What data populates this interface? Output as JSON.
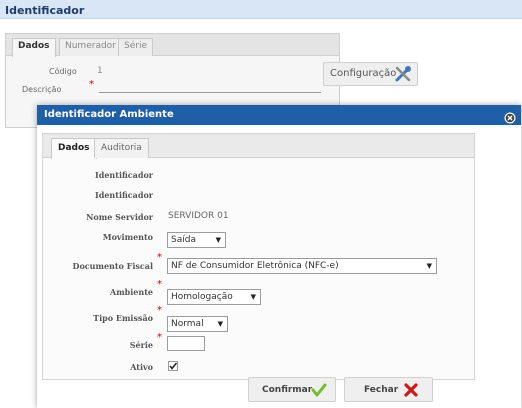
{
  "window": {
    "title": "Identificador"
  },
  "background_form": {
    "tabs": [
      "Dados",
      "Numerador",
      "Série"
    ],
    "fields": {
      "codigo_label": "Código",
      "codigo_value": "1",
      "descricao_label": "Descrição"
    },
    "config_button_label": "Configuração"
  },
  "modal": {
    "title": "Identificador Ambiente",
    "tabs": [
      "Dados",
      "Auditoria"
    ],
    "fields": {
      "identificador_1": {
        "label": "Identificador",
        "value": ""
      },
      "identificador_2": {
        "label": "Identificador",
        "value": ""
      },
      "nome_servidor": {
        "label": "Nome Servidor",
        "value": "SERVIDOR 01"
      },
      "movimento": {
        "label": "Movimento",
        "value": "Saída"
      },
      "documento_fiscal": {
        "label": "Documento Fiscal",
        "value": "NF de Consumidor Eletrônica (NFC-e)"
      },
      "ambiente": {
        "label": "Ambiente",
        "value": "Homologação"
      },
      "tipo_emissao": {
        "label": "Tipo Emissão",
        "value": "Normal"
      },
      "serie": {
        "label": "Série",
        "value": ""
      },
      "ativo": {
        "label": "Ativo",
        "checked": true
      }
    },
    "buttons": {
      "confirm": "Confirmar",
      "close": "Fechar"
    }
  },
  "colors": {
    "modal_header": "#1f5fa8",
    "title_bar": "#d9e6f5",
    "required_marker": "#d00000",
    "confirm_icon": "#6fbf2a",
    "close_icon": "#d01818"
  },
  "icons": {
    "config": "wrench-screwdriver-icon",
    "modal_close": "close-circle-icon",
    "confirm": "checkmark-icon",
    "close": "x-icon",
    "select_arrow": "triangle-down-icon"
  }
}
